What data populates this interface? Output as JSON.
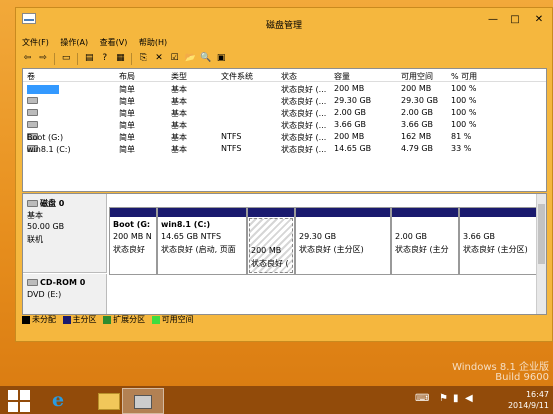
{
  "window": {
    "title": "磁盘管理"
  },
  "titlebar": {
    "minimize": "—",
    "maximize": "□",
    "close": "✕"
  },
  "menu": [
    "文件(F)",
    "操作(A)",
    "查看(V)",
    "帮助(H)"
  ],
  "toolbar": {
    "icons": [
      "back-arrow-icon",
      "forward-arrow-icon",
      "show-hide-console-icon",
      "properties-icon",
      "help-icon",
      "disk-list-icon",
      "connect-icon",
      "delete-icon",
      "properties2-icon",
      "open-folder-icon",
      "search-icon",
      "refresh-icon"
    ],
    "glyphs": [
      "⇦",
      "⇨",
      "▭",
      "▤",
      "?",
      "▦",
      "⎘",
      "✕",
      "☑",
      "📂",
      "🔍",
      "▣"
    ]
  },
  "volume_table": {
    "headers": [
      "卷",
      "布局",
      "类型",
      "文件系统",
      "状态",
      "容量",
      "可用空间",
      "% 可用"
    ],
    "rows": [
      {
        "volume": "",
        "layout": "简单",
        "type": "基本",
        "fs": "",
        "status": "状态良好 (...",
        "capacity": "200 MB",
        "free": "200 MB",
        "pct": "100 %"
      },
      {
        "volume": "",
        "layout": "简单",
        "type": "基本",
        "fs": "",
        "status": "状态良好 (...",
        "capacity": "29.30 GB",
        "free": "29.30 GB",
        "pct": "100 %"
      },
      {
        "volume": "",
        "layout": "简单",
        "type": "基本",
        "fs": "",
        "status": "状态良好 (...",
        "capacity": "2.00 GB",
        "free": "2.00 GB",
        "pct": "100 %"
      },
      {
        "volume": "",
        "layout": "简单",
        "type": "基本",
        "fs": "",
        "status": "状态良好 (...",
        "capacity": "3.66 GB",
        "free": "3.66 GB",
        "pct": "100 %"
      },
      {
        "volume": "Boot (G:)",
        "layout": "简单",
        "type": "基本",
        "fs": "NTFS",
        "status": "状态良好 (...",
        "capacity": "200 MB",
        "free": "162 MB",
        "pct": "81 %"
      },
      {
        "volume": "win8.1 (C:)",
        "layout": "简单",
        "type": "基本",
        "fs": "NTFS",
        "status": "状态良好 (...",
        "capacity": "14.65 GB",
        "free": "4.79 GB",
        "pct": "33 %"
      }
    ]
  },
  "disk0": {
    "name": "磁盘 0",
    "kind": "基本",
    "size": "50.00 GB",
    "status": "联机",
    "partitions": [
      {
        "title": "Boot (G:",
        "line1": "200 MB N",
        "line2": "状态良好"
      },
      {
        "title": "win8.1 (C:)",
        "line1": "14.65 GB NTFS",
        "line2": "状态良好 (启动, 页面"
      },
      {
        "title": "",
        "line1": "200 MB",
        "line2": "状态良好 ("
      },
      {
        "title": "",
        "line1": "29.30 GB",
        "line2": "状态良好 (主分区)"
      },
      {
        "title": "",
        "line1": "2.00 GB",
        "line2": "状态良好 (主分"
      },
      {
        "title": "",
        "line1": "3.66 GB",
        "line2": "状态良好 (主分区)"
      }
    ]
  },
  "cdrom": {
    "name": "CD-ROM 0",
    "kind": "DVD (E:)"
  },
  "legend": [
    {
      "label": "未分配",
      "color": "#000000"
    },
    {
      "label": "主分区",
      "color": "#1a1a6e"
    },
    {
      "label": "扩展分区",
      "color": "#2e8b2e"
    },
    {
      "label": "可用空间",
      "color": "#3fdc3f"
    }
  ],
  "watermark": {
    "line1": "Windows 8.1 企业版",
    "line2": "Build 9600"
  },
  "taskbar": {
    "time": "16:47",
    "date": "2014/9/11"
  },
  "tray_icons": [
    "keyboard-icon",
    "action-center-flag-icon",
    "network-icon",
    "volume-icon",
    "show-desktop-icon"
  ],
  "tray_glyphs": [
    "⌨",
    "⚑",
    "▮",
    "◀",
    "▫"
  ]
}
